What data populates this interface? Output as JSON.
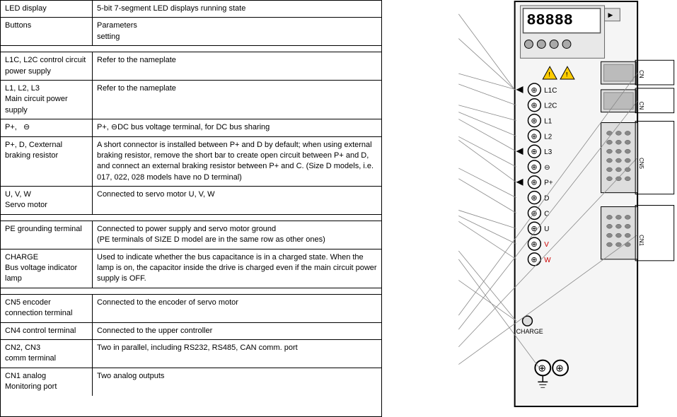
{
  "table": {
    "rows": [
      {
        "name": "LED display",
        "desc": "5-bit 7-segment LED displays running state"
      },
      {
        "name": "Buttons",
        "desc": "Parameters\nsetting"
      },
      {
        "name": "SECTION_GAP_1",
        "desc": ""
      },
      {
        "name": "L1C, L2C control circuit power supply",
        "desc": "Refer to the nameplate"
      },
      {
        "name": "L1, L2, L3\nMain circuit power supply",
        "desc": "Refer to the nameplate"
      },
      {
        "name": "P+,   ⊖",
        "desc": "P+, ⊖DC bus voltage terminal, for DC bus sharing"
      },
      {
        "name": "P+, D, Cexternal braking resistor",
        "desc": "A short connector is installed between P+ and D by default; when using external braking resistor, remove the short bar to create open circuit between P+ and D, and connect an external braking resistor between P+ and C. (Size D models, i.e. 017, 022, 028 models have no D terminal)"
      },
      {
        "name": "U, V, W\nServo motor",
        "desc": "Connected to servo motor U, V, W"
      },
      {
        "name": "SECTION_GAP_2",
        "desc": ""
      },
      {
        "name": "PE grounding terminal",
        "desc": "Connected to power supply and servo motor ground\n(PE terminals of SIZE D model are in the same row as other ones)"
      },
      {
        "name": "CHARGE\nBus voltage indicator lamp",
        "desc": "Used to indicate whether the bus capacitance is in a charged state. When the lamp is on, the capacitor inside the drive is charged even if the main circuit power supply is OFF."
      },
      {
        "name": "SECTION_GAP_3",
        "desc": ""
      },
      {
        "name": "CN5 encoder connection terminal",
        "desc": "Connected to the encoder of servo motor"
      },
      {
        "name": "CN4 control terminal",
        "desc": "Connected to the upper controller"
      },
      {
        "name": "CN2, CN3\ncomm terminal",
        "desc": "Two in parallel, including RS232, RS485, CAN comm. port"
      },
      {
        "name": "CN1 analog\nMonitoring port",
        "desc": "Two analog outputs"
      }
    ]
  },
  "diagram": {
    "led_digits": "88888",
    "terminal_labels": [
      "L1C",
      "L2C",
      "L1",
      "L2",
      "L3",
      "⊖",
      "P+",
      "D",
      "C",
      "U",
      "V",
      "W"
    ],
    "charge_label": "CHARGE",
    "warning_label": "⚠"
  }
}
